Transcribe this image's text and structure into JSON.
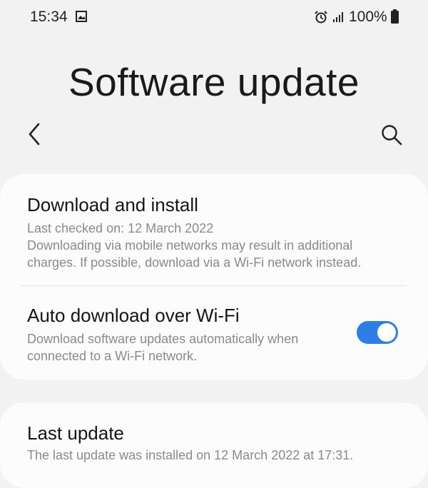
{
  "status_bar": {
    "time": "15:34",
    "battery": "100%",
    "icons": [
      "gallery-icon",
      "alarm-icon",
      "signal-icon",
      "battery-icon"
    ]
  },
  "header": {
    "title": "Software update",
    "back_icon": "chevron-left-icon",
    "search_icon": "search-icon"
  },
  "download_install": {
    "title": "Download and install",
    "subtitle": "Last checked on: 12 March 2022",
    "note_line1": "Downloading via mobile networks may result in additional",
    "note_line2": "charges. If possible, download via a Wi-Fi network instead."
  },
  "auto_download": {
    "title": "Auto download over Wi-Fi",
    "desc_line1": "Download software updates automatically when",
    "desc_line2": "connected to a Wi-Fi network.",
    "toggle_on": true
  },
  "last_update": {
    "title": "Last update",
    "desc": "The last update was installed on 12 March 2022 at 17:31."
  },
  "colors": {
    "background": "#f2f2f2",
    "card": "#fcfcfc",
    "accent": "#2e7ee6",
    "secondary_text": "#8a8a8a"
  }
}
